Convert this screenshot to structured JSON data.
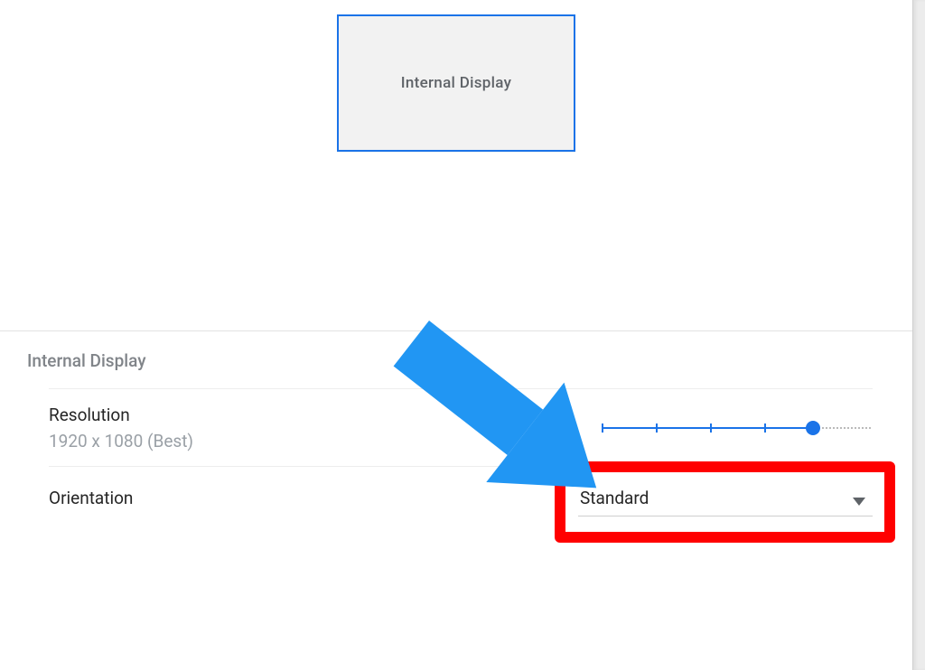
{
  "preview": {
    "display_tile_label": "Internal Display"
  },
  "section": {
    "title": "Internal Display",
    "resolution": {
      "label": "Resolution",
      "value_text": "1920 x 1080 (Best)",
      "slider_percent": 78
    },
    "orientation": {
      "label": "Orientation",
      "selected": "Standard"
    }
  }
}
